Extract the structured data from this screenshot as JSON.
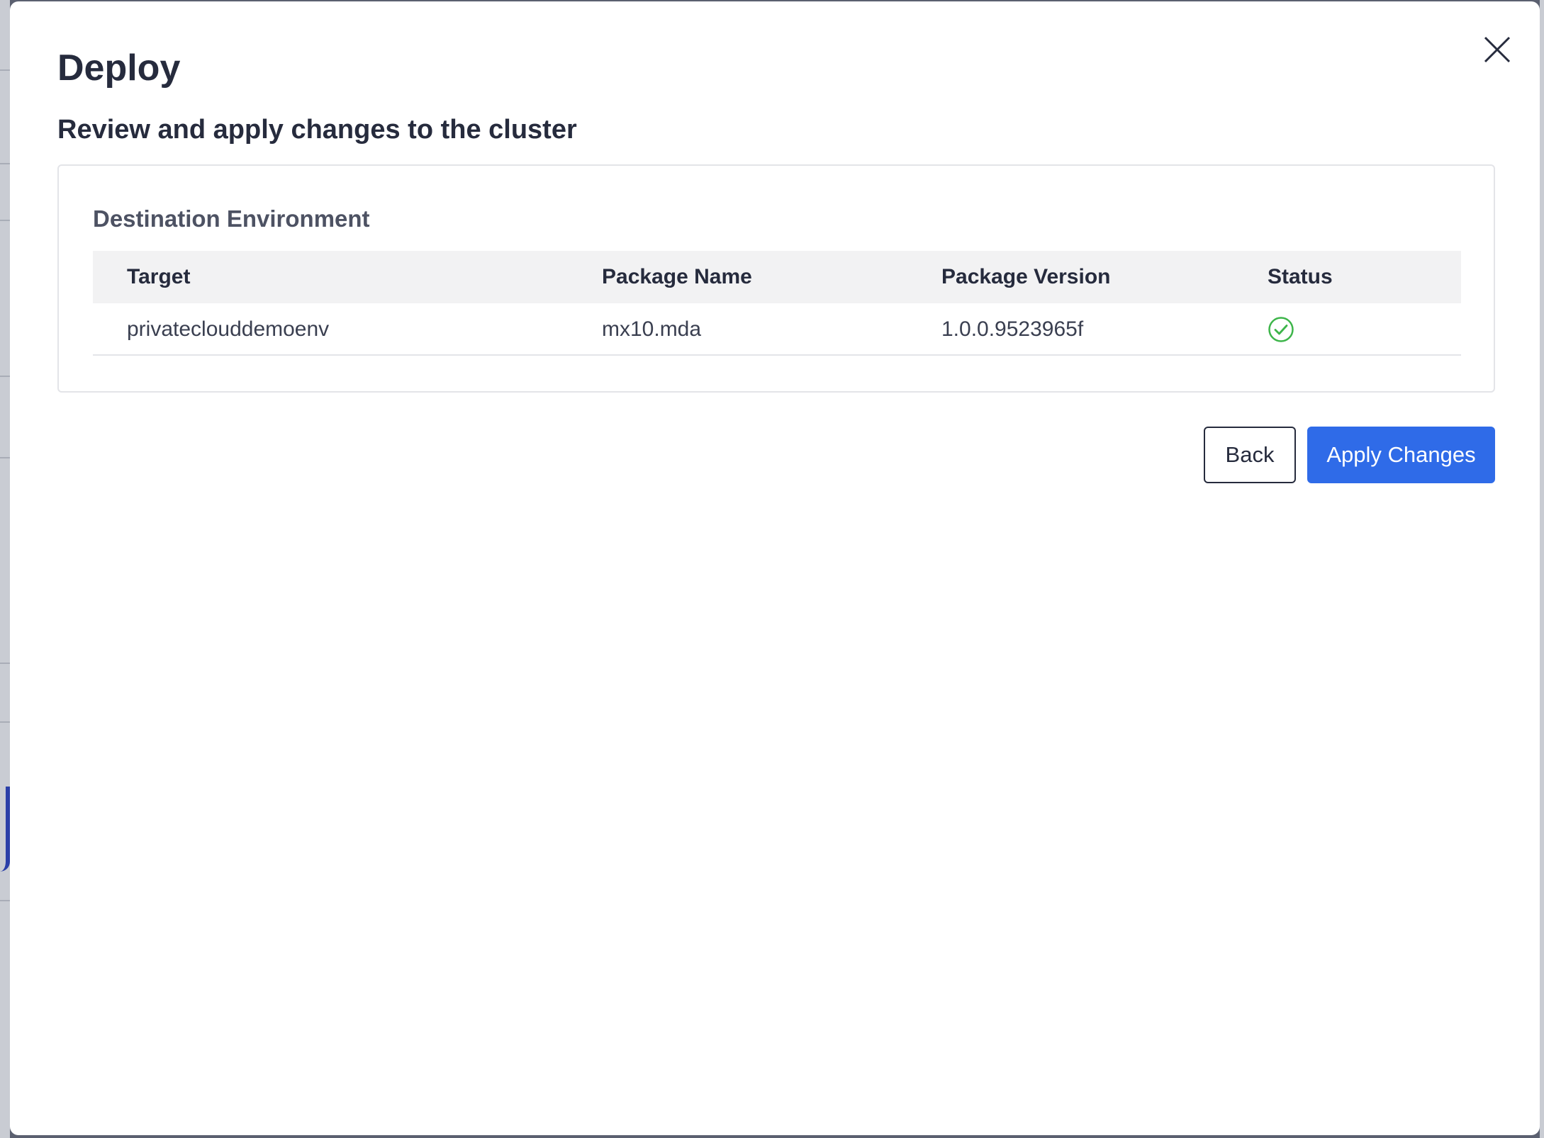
{
  "modal": {
    "title": "Deploy",
    "subtitle": "Review and apply changes to the cluster"
  },
  "card": {
    "title": "Destination Environment",
    "columns": [
      "Target",
      "Package Name",
      "Package Version",
      "Status"
    ],
    "rows": [
      {
        "target": "privateclouddemoenv",
        "package_name": "mx10.mda",
        "package_version": "1.0.0.9523965f",
        "status_icon": "check-circle-icon",
        "status_color": "#3db54a"
      }
    ]
  },
  "actions": {
    "back_label": "Back",
    "apply_label": "Apply Changes"
  },
  "colors": {
    "primary": "#2f6be8",
    "text": "#262b3d"
  }
}
